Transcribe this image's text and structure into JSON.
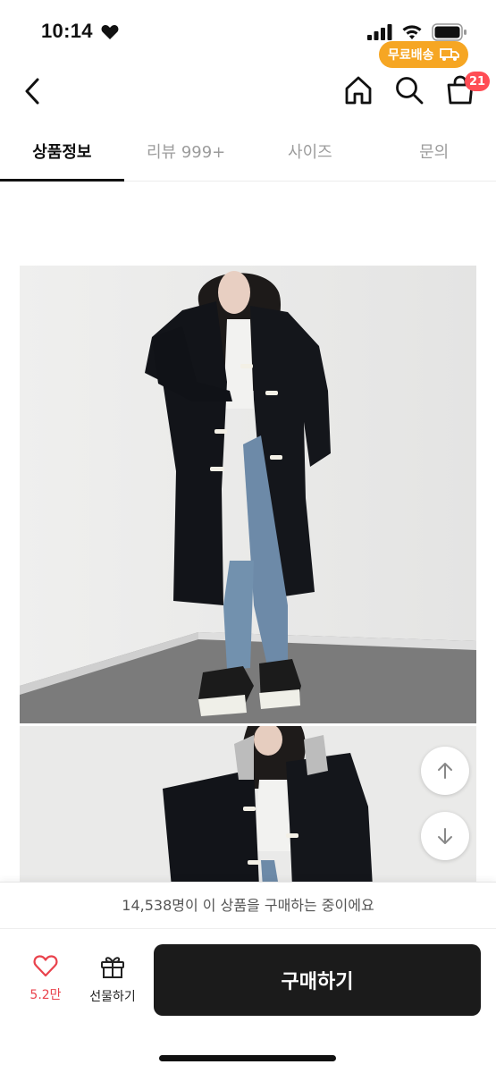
{
  "status_bar": {
    "time": "10:14"
  },
  "cart": {
    "badge_count": "21"
  },
  "tabs": [
    {
      "label": "상품정보",
      "active": true
    },
    {
      "label": "리뷰 999+",
      "active": false
    },
    {
      "label": "사이즈",
      "active": false
    },
    {
      "label": "문의",
      "active": false
    }
  ],
  "icons": {
    "back": "chevron-left-icon",
    "home": "home-icon",
    "search": "search-icon",
    "cart": "shopping-bag-icon",
    "scroll_up": "arrow-up-icon",
    "scroll_down": "arrow-down-icon",
    "like": "heart-icon",
    "gift": "gift-icon",
    "shipping": "truck-icon"
  },
  "bottom": {
    "buying_now": "14,538명이 이 상품을 구매하는 중이에요",
    "like_count": "5.2만",
    "gift_label": "선물하기",
    "buy_label": "구매하기",
    "free_shipping_label": "무료배송"
  },
  "colors": {
    "accent_red": "#e9424c",
    "badge_red": "#ff4d55",
    "buy_button": "#1b1b1b",
    "free_shipping": "#f6a623"
  }
}
